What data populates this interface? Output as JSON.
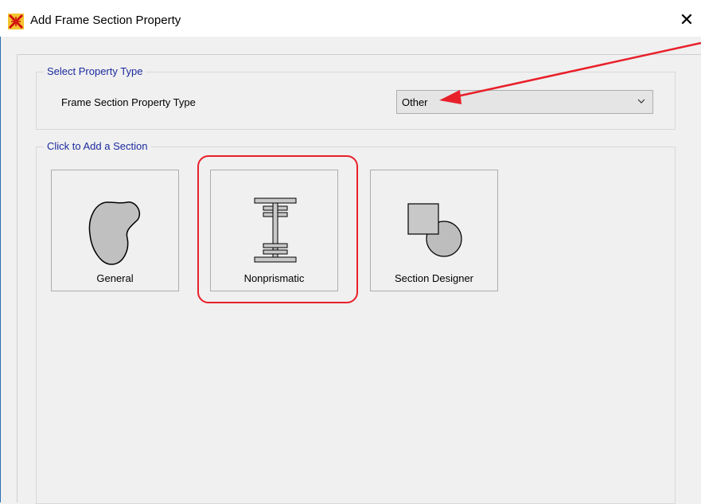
{
  "window": {
    "title": "Add Frame Section Property",
    "close_label": "✕"
  },
  "select_type_group": {
    "legend": "Select Property Type",
    "property_label": "Frame Section Property Type",
    "dropdown_value": "Other"
  },
  "add_section_group": {
    "legend": "Click to Add a Section",
    "tiles": [
      {
        "label": "General",
        "icon": "general-shape-icon"
      },
      {
        "label": "Nonprismatic",
        "icon": "i-beam-icon"
      },
      {
        "label": "Section Designer",
        "icon": "section-designer-icon"
      }
    ]
  },
  "annotations": {
    "highlight_color": "#e8202a",
    "arrow_color": "#e8202a"
  }
}
